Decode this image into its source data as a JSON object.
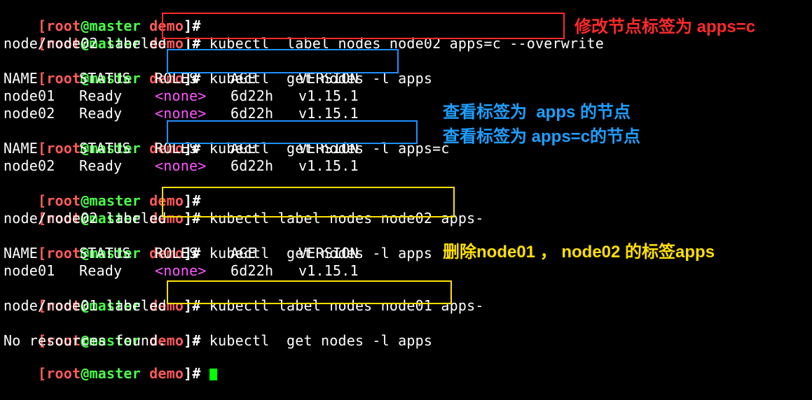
{
  "prompt": {
    "open": "[",
    "user": "root",
    "at": "@",
    "host": "master",
    "dir": "demo",
    "close": "]#"
  },
  "commands": {
    "c1": "kubectl  label nodes node02 apps=c --overwrite",
    "c2": "kubectl  get nodes -l apps",
    "c3": "kubectl  get nodes -l apps=c",
    "c4": "kubectl label nodes node02 apps-",
    "c5": "kubectl  get nodes -l apps",
    "c6": "kubectl label nodes node01 apps-",
    "c7": "kubectl  get nodes -l apps"
  },
  "outputs": {
    "labeled_node02": "node/node02 labeled",
    "labeled_node01": "node/node01 labeled",
    "no_resources": "No resources found."
  },
  "table": {
    "headers": [
      "NAME",
      "STATUS",
      "ROLES",
      "AGE",
      "VERSION"
    ],
    "t1": [
      [
        "node01",
        "Ready",
        "<none>",
        "6d22h",
        "v1.15.1"
      ],
      [
        "node02",
        "Ready",
        "<none>",
        "6d22h",
        "v1.15.1"
      ]
    ],
    "t2": [
      [
        "node02",
        "Ready",
        "<none>",
        "6d22h",
        "v1.15.1"
      ]
    ],
    "t3": [
      [
        "node01",
        "Ready",
        "<none>",
        "6d22h",
        "v1.15.1"
      ]
    ]
  },
  "annotations": {
    "a1": "修改节点标签为 apps=c",
    "a2": "查看标签为  apps 的节点",
    "a3": "查看标签为 apps=c的节点",
    "a4": "删除node01 ， node02 的标签apps"
  },
  "colors": {
    "background": "#000000",
    "prompt_red": "#ff5a5a",
    "prompt_green": "#4aff4a",
    "none_magenta": "#ff55ff",
    "cursor_green": "#00ff00",
    "box_red": "#ff2a2a",
    "box_blue": "#1e90ff",
    "box_yellow": "#ffe000",
    "note_red": "#ff2a2a",
    "note_blue": "#1e9fff",
    "note_yellow": "#ffe000"
  }
}
